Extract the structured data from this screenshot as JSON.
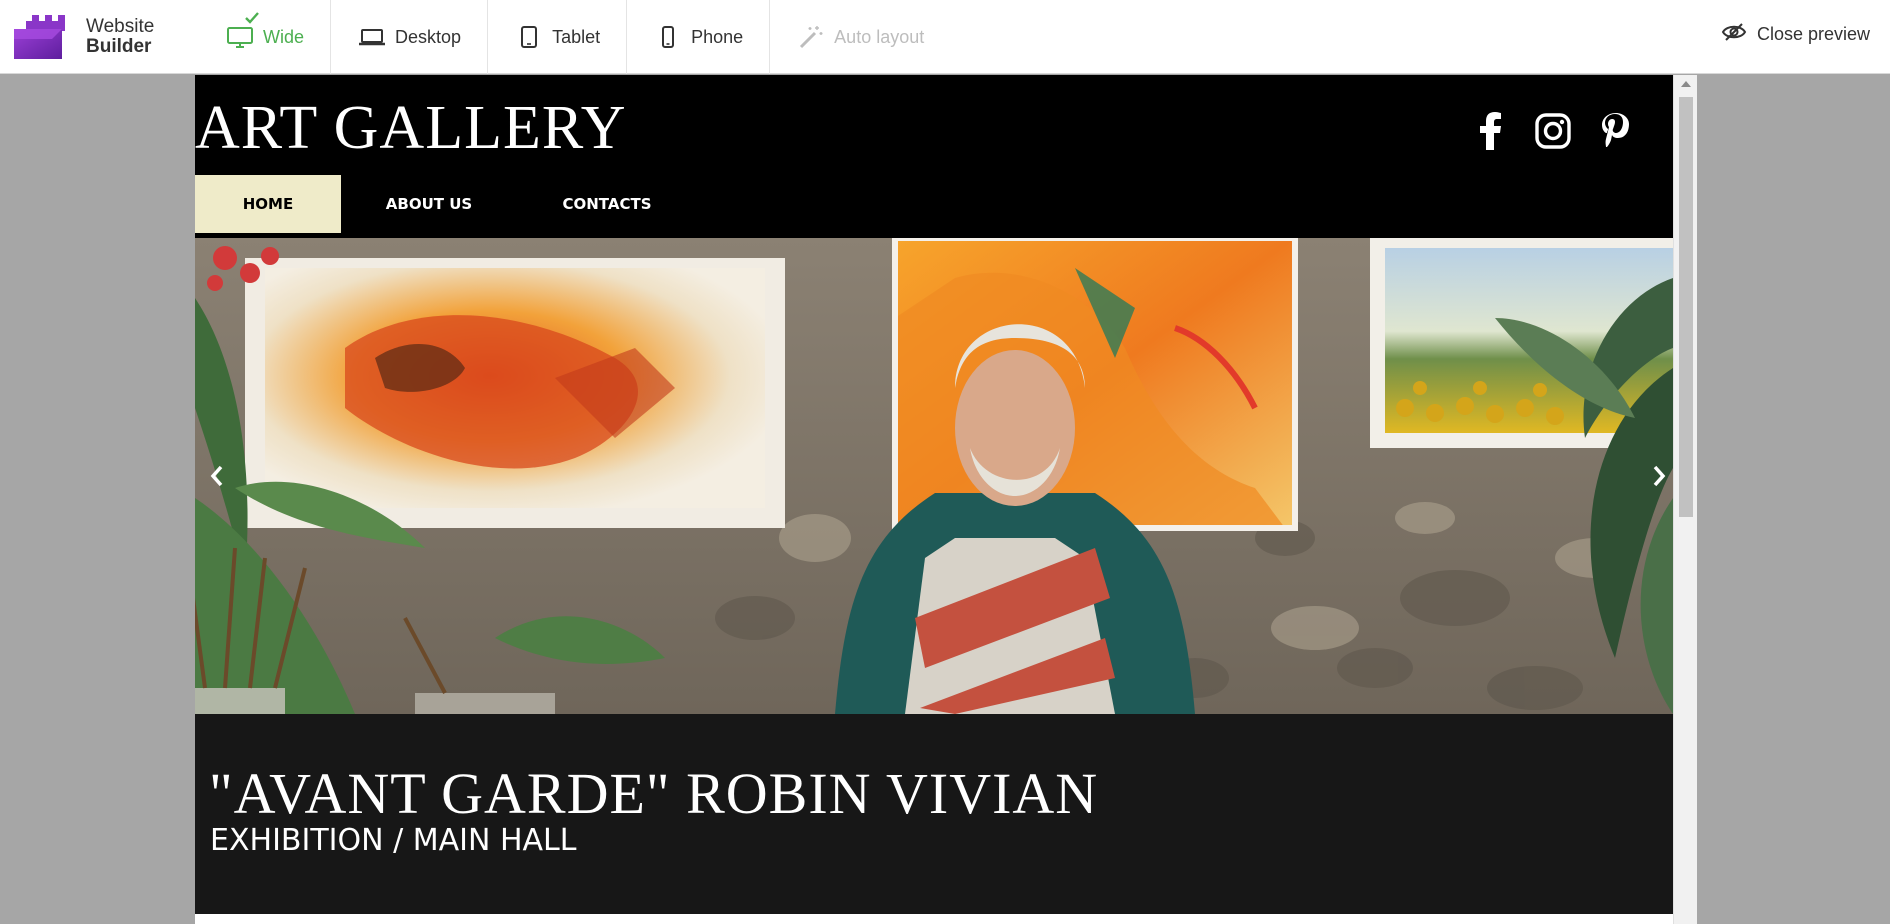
{
  "builder": {
    "logo": {
      "line1": "Website",
      "line2": "Builder"
    },
    "devices": [
      {
        "label": "Wide",
        "icon": "monitor-icon",
        "state": "active"
      },
      {
        "label": "Desktop",
        "icon": "laptop-icon",
        "state": "normal"
      },
      {
        "label": "Tablet",
        "icon": "tablet-icon",
        "state": "normal"
      },
      {
        "label": "Phone",
        "icon": "phone-icon",
        "state": "normal"
      },
      {
        "label": "Auto layout",
        "icon": "magic-wand-icon",
        "state": "disabled"
      }
    ],
    "close_preview": "Close preview"
  },
  "site": {
    "title": "ART GALLERY",
    "socials": [
      "facebook-icon",
      "instagram-icon",
      "pinterest-icon"
    ],
    "nav": [
      {
        "label": "HOME",
        "active": true
      },
      {
        "label": "ABOUT US",
        "active": false
      },
      {
        "label": "CONTACTS",
        "active": false
      }
    ],
    "hero": {
      "description_icon": "painter-photo"
    },
    "caption": {
      "title": "\"AVANT GARDE\" ROBIN VIVIAN",
      "subtitle": "EXHIBITION / MAIN HALL"
    }
  },
  "colors": {
    "accent_green": "#4caf50",
    "logo_purple": "#7b2fbe",
    "nav_active_bg": "#efebc9",
    "caption_bg": "#171717"
  }
}
